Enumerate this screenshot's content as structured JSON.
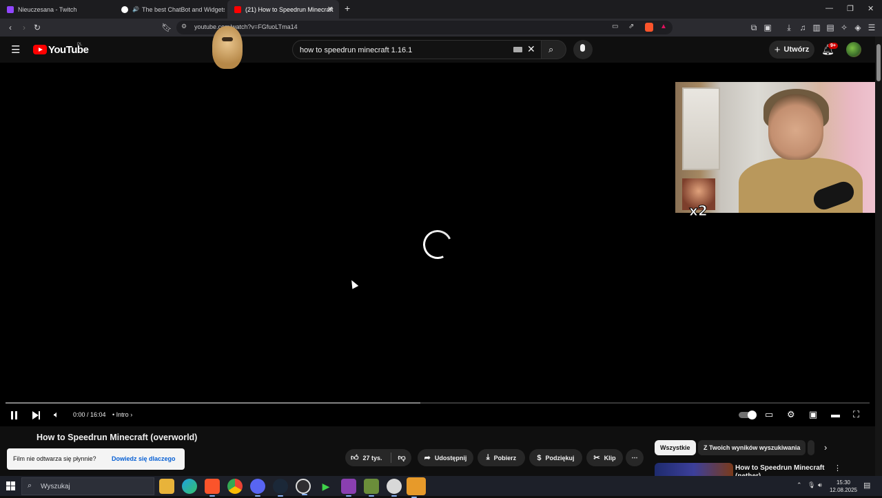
{
  "browser": {
    "tabs": [
      {
        "title": "Nieuczesana - Twitch",
        "active": false,
        "favicon_color": "#9146ff"
      },
      {
        "title": "The best ChatBot and Widgets fo",
        "active": false,
        "favicon_color": "#ffffff"
      },
      {
        "title": "(21) How to Speedrun Minecraft",
        "active": true,
        "favicon_color": "#ff0000"
      }
    ],
    "new_tab_label": "+",
    "url": "youtube.com/watch?v=FGfuoLTma14",
    "window_controls": {
      "minimize": "—",
      "restore": "❐",
      "close": "✕"
    }
  },
  "youtube": {
    "logo_text": "YouTube",
    "region": "PL",
    "search_query": "how to speedrun minecraft 1.16.1",
    "create_label": "Utwórz",
    "notification_badge": "9+"
  },
  "player": {
    "time": "0:00 / 16:04",
    "chapter": "Intro",
    "chapter_sep": "•",
    "chapter_arrow": "›",
    "state": "loading",
    "progress_fraction": 0.0,
    "buffered_fraction": 0.48
  },
  "overlay": {
    "emote_multiplier": "x2"
  },
  "video": {
    "title": "How to Speedrun Minecraft (overworld)",
    "likes": "27 tys.",
    "share_label": "Udostępnij",
    "download_label": "Pobierz",
    "thanks_label": "Podziękuj",
    "clip_label": "Klip",
    "more_label": "⋯"
  },
  "toast": {
    "message": "Film nie odtwarza się płynnie?",
    "link": "Dowiedz się dlaczego"
  },
  "recommendations": {
    "chips": [
      "Wszystkie",
      "Z Twoich wyników wyszukiwania"
    ],
    "first_title_line1": "How to Speedrun Minecraft",
    "first_title_line2": "(nether)"
  },
  "taskbar": {
    "search_placeholder": "Wyszukaj",
    "time": "15:30",
    "date": "12.08.2025"
  }
}
